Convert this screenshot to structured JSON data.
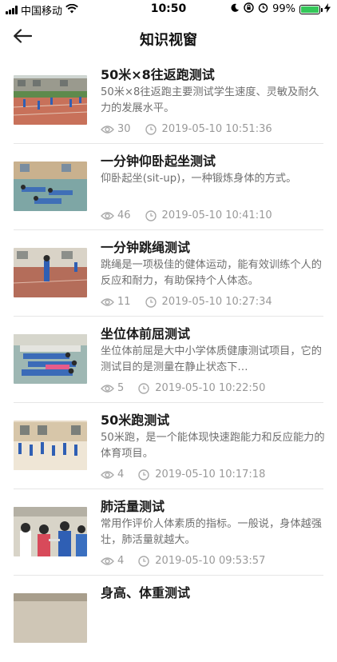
{
  "status_bar": {
    "carrier": "中国移动",
    "time": "10:50",
    "battery_percent": "99%",
    "battery_level": 0.99,
    "icons": [
      "signal-icon",
      "wifi-icon",
      "moon-icon",
      "lock-rotation-icon",
      "alarm-icon",
      "battery-icon",
      "charging-icon"
    ]
  },
  "nav": {
    "back_icon": "back-arrow-icon",
    "title": "知识视窗"
  },
  "items": [
    {
      "title": "50米×8往返跑测试",
      "desc": "50米×8往返跑主要测试学生速度、灵敏及耐久力的发展水平。",
      "views": "30",
      "date": "2019-05-10 10:51:36"
    },
    {
      "title": "一分钟仰卧起坐测试",
      "desc": "仰卧起坐(sit-up)，一种锻炼身体的方式。",
      "views": "46",
      "date": "2019-05-10 10:41:10"
    },
    {
      "title": "一分钟跳绳测试",
      "desc": "跳绳是一项极佳的健体运动，能有效训练个人的反应和耐力，有助保持个人体态。",
      "views": "11",
      "date": "2019-05-10 10:27:34"
    },
    {
      "title": "坐位体前屈测试",
      "desc": "坐位体前屈是大中小学体质健康测试项目，它的测试目的是测量在静止状态下…",
      "views": "5",
      "date": "2019-05-10 10:22:50"
    },
    {
      "title": "50米跑测试",
      "desc": "50米跑，是一个能体现快速跑能力和反应能力的体育项目。",
      "views": "4",
      "date": "2019-05-10 10:17:18"
    },
    {
      "title": "肺活量测试",
      "desc": "常用作评价人体素质的指标。一般说，身体越强壮，肺活量就越大。",
      "views": "4",
      "date": "2019-05-10 09:53:57"
    },
    {
      "title": "身高、体重测试",
      "desc": "",
      "views": "",
      "date": ""
    }
  ],
  "colors": {
    "accent_track": "#c8715a",
    "uniform_blue": "#2f5fb4",
    "meta_gray": "#999999",
    "battery_green": "#34c759"
  }
}
